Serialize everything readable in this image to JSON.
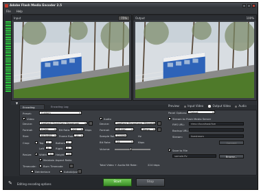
{
  "window": {
    "title": "Adobe Flash Media Encoder 2.5"
  },
  "menu": {
    "file": "File",
    "help": "Help"
  },
  "input_panel": {
    "label": "Input",
    "zoom": "75%"
  },
  "output_panel": {
    "label": "Output",
    "zoom": "100%"
  },
  "tabs": {
    "encoding_options": "Encoding Options",
    "encoding_log": "Encoding Log"
  },
  "preview": {
    "label": "Preview:",
    "input_video": "Input Video",
    "output_video": "Output Video",
    "audio": "Audio"
  },
  "preset": {
    "label": "Preset:",
    "value": "Custom"
  },
  "video": {
    "enabled_label": "Video",
    "device_label": "Device:",
    "device_value": "Logitech QuickCam Messenger",
    "format_label": "Format:",
    "format_value": "H.264",
    "bitrate_label": "Bit Rate:",
    "bitrate_value": "200",
    "bitrate_unit": "Kbps",
    "size_label": "Size:",
    "size_value": "640x480",
    "fps_label": "Frame Rate:",
    "fps_value": "15",
    "crop_label": "Crop:",
    "top_label": "Top",
    "top_value": "0",
    "bottom_label": "Bottom",
    "bottom_value": "0",
    "left_label": "Left",
    "left_value": "0",
    "right_label": "Right",
    "right_value": "0",
    "resize_label": "Resize:",
    "width_label": "Width",
    "width_value": "320",
    "height_label": "Height",
    "height_value": "240",
    "maintain_label": "Maintain Aspect Ratio"
  },
  "timecode": {
    "label": "Timecode:",
    "burn_label": "Burn Timecode",
    "deinterlace_label": "Deinterlace",
    "autoadjust_label": "AutoAdjust"
  },
  "audio": {
    "enabled_label": "Audio",
    "device_label": "Device:",
    "device_value": "Logitech Microphone (Messenger",
    "format_label": "Format:",
    "format_value": "HE-AAC",
    "channels_value": "Mono",
    "samplerate_label": "Sample Rate:",
    "samplerate_value": "22050",
    "samplerate_unit": "Hz",
    "bitrate_label": "Bit Rate:",
    "bitrate_value": "24",
    "bitrate_unit": "Kbps",
    "volume_label": "Volume:",
    "volume_level": 0.45,
    "total_label": "Total Video + Audio Bit Rate:",
    "total_value": "224 kbps"
  },
  "panel_options": {
    "label": "Panel Options:",
    "value": "Output"
  },
  "stream": {
    "checkbox_label": "Stream to Flash Media Server",
    "fms_label": "FMS URL:",
    "fms_value": "rtmp://localhost/live",
    "backup_label": "Backup URL:",
    "stream_label": "Stream:",
    "stream_value": "livestream",
    "connect_label": "Connect"
  },
  "save": {
    "checkbox_label": "Save to File",
    "file_value": "sample.flv",
    "browse_label": "Browse..."
  },
  "bottom": {
    "status": "Editing encoding options",
    "start_label": "Start",
    "stop_label": "Stop"
  },
  "colors": {
    "accent_green": "#4caf50",
    "meter": "#2ecc40",
    "background": "#2a2d31"
  }
}
